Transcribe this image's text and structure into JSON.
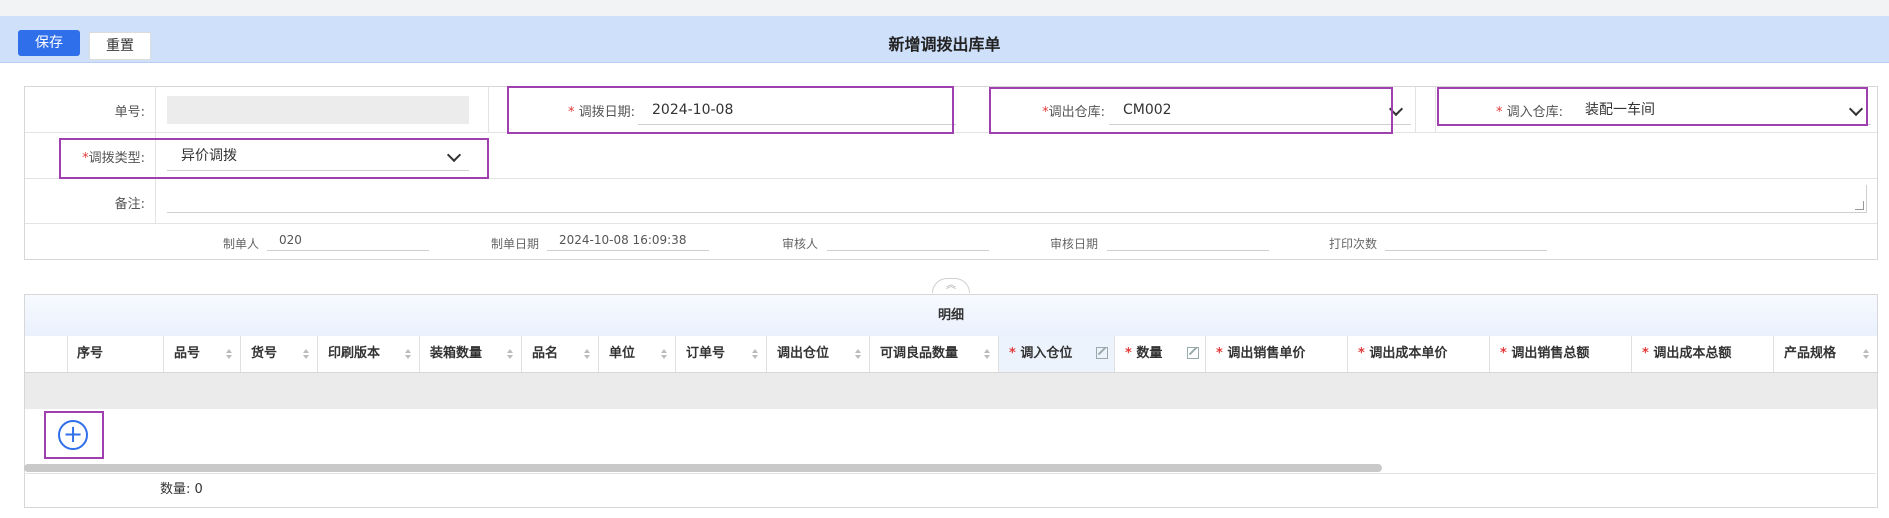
{
  "toolbar": {
    "save_label": "保存",
    "reset_label": "重置"
  },
  "page_title": "新增调拨出库单",
  "form": {
    "order_no": {
      "label": "单号:",
      "value": ""
    },
    "transfer_date": {
      "label": "调拨日期:",
      "value": "2024-10-08",
      "required_mark": "* "
    },
    "out_warehouse": {
      "label": "调出仓库:",
      "value": "CM002",
      "required_mark": "*"
    },
    "in_warehouse": {
      "label": "调入仓库:",
      "value": "装配一车间",
      "required_mark": "* "
    },
    "transfer_type": {
      "label": "调拨类型:",
      "value": "异价调拨",
      "required_mark": "*"
    },
    "remark": {
      "label": "备注:",
      "value": ""
    }
  },
  "meta": {
    "creator": {
      "label": "制单人",
      "value": "020"
    },
    "create_date": {
      "label": "制单日期",
      "value": "2024-10-08 16:09:38"
    },
    "reviewer": {
      "label": "审核人",
      "value": ""
    },
    "review_date": {
      "label": "审核日期",
      "value": ""
    },
    "print_count": {
      "label": "打印次数",
      "value": ""
    }
  },
  "detail": {
    "title": "明细",
    "columns": [
      {
        "label": "序号"
      },
      {
        "label": "品号"
      },
      {
        "label": "货号"
      },
      {
        "label": "印刷版本"
      },
      {
        "label": "装箱数量"
      },
      {
        "label": "品名"
      },
      {
        "label": "单位"
      },
      {
        "label": "订单号"
      },
      {
        "label": "调出仓位"
      },
      {
        "label": "可调良品数量"
      },
      {
        "label": "调入仓位",
        "required_mark": "* "
      },
      {
        "label": "数量",
        "required_mark": "* "
      },
      {
        "label": "调出销售单价",
        "required_mark": "* "
      },
      {
        "label": "调出成本单价",
        "required_mark": "* "
      },
      {
        "label": "调出销售总额",
        "required_mark": "* "
      },
      {
        "label": "调出成本总额",
        "required_mark": "* "
      },
      {
        "label": "产品规格"
      }
    ],
    "footer": {
      "count_label": "数量:",
      "count_value": "0"
    }
  },
  "colors": {
    "primary": "#2f6fea",
    "header_bg": "#cfe0fb",
    "highlight": "#a040b0",
    "required": "#e23b3b"
  },
  "icons": {
    "add": "plus-circle-icon",
    "edit": "edit-icon",
    "collapse": "double-chevron-up-icon",
    "dropdown": "chevron-down-icon",
    "sort": "sort-icon"
  }
}
